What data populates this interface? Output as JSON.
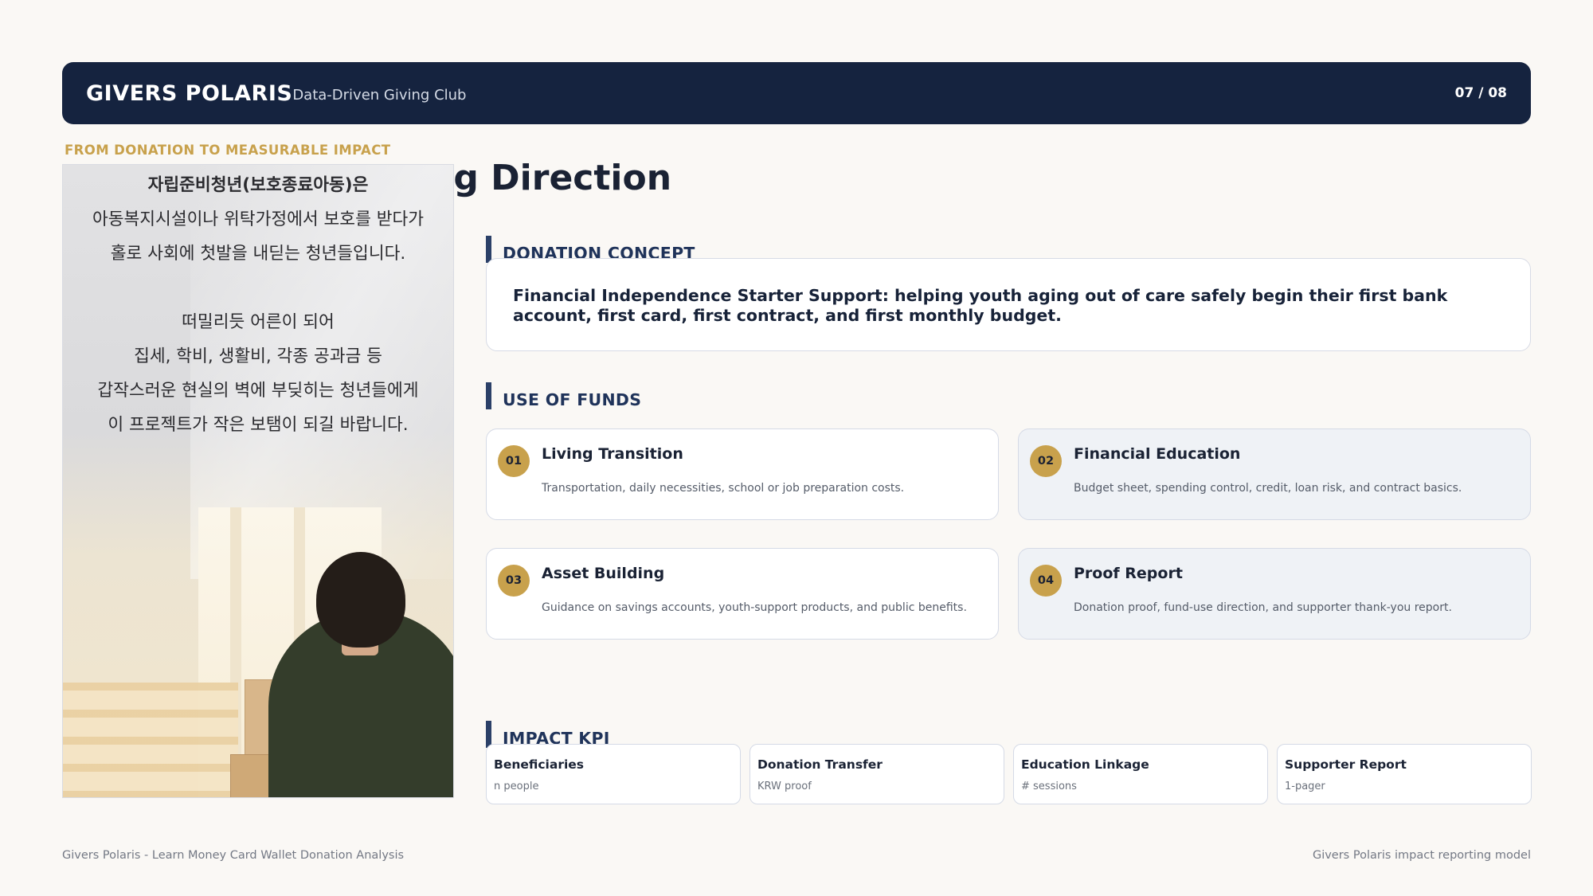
{
  "header": {
    "brand": "GIVERS POLARIS",
    "subtitle": "Data-Driven Giving Club",
    "page_indicator": "07 / 08"
  },
  "kicker": "FROM DONATION TO MEASURABLE IMPACT",
  "title": "ng Direction",
  "photo_panel": {
    "lines": [
      "자립준비청년(보호종료아동)은",
      "아동복지시설이나 위탁가정에서 보호를 받다가",
      "홀로 사회에 첫발을 내딛는 청년들입니다.",
      "",
      "떠밀리듯 어른이 되어",
      "집세, 학비, 생활비, 각종 공과금 등",
      "갑작스러운 현실의 벽에 부딪히는 청년들에게",
      "이 프로젝트가 작은 보탬이 되길 바랍니다."
    ]
  },
  "concept": {
    "heading": "DONATION CONCEPT",
    "text": "Financial Independence Starter Support: helping youth aging out of care safely begin their first bank account, first card, first contract, and first monthly budget."
  },
  "funds": {
    "heading": "USE OF FUNDS",
    "items": [
      {
        "num": "01",
        "title": "Living Transition",
        "desc": "Transportation, daily necessities, school or job preparation costs."
      },
      {
        "num": "02",
        "title": "Financial Education",
        "desc": "Budget sheet, spending control, credit, loan risk, and contract basics."
      },
      {
        "num": "03",
        "title": "Asset Building",
        "desc": "Guidance on savings accounts, youth-support products, and public benefits."
      },
      {
        "num": "04",
        "title": "Proof Report",
        "desc": "Donation proof, fund-use direction, and supporter thank-you report."
      }
    ]
  },
  "kpi": {
    "heading": "IMPACT KPI",
    "items": [
      {
        "title": "Beneficiaries",
        "value": "n people"
      },
      {
        "title": "Donation Transfer",
        "value": "KRW proof"
      },
      {
        "title": "Education Linkage",
        "value": "# sessions"
      },
      {
        "title": "Supporter Report",
        "value": "1-pager"
      }
    ]
  },
  "footer": {
    "left": "Givers Polaris - Learn Money Card Wallet Donation Analysis",
    "right": "Givers Polaris impact reporting model"
  },
  "colors": {
    "navy": "#15233f",
    "gold": "#c8a14c",
    "background": "#faf8f5"
  }
}
